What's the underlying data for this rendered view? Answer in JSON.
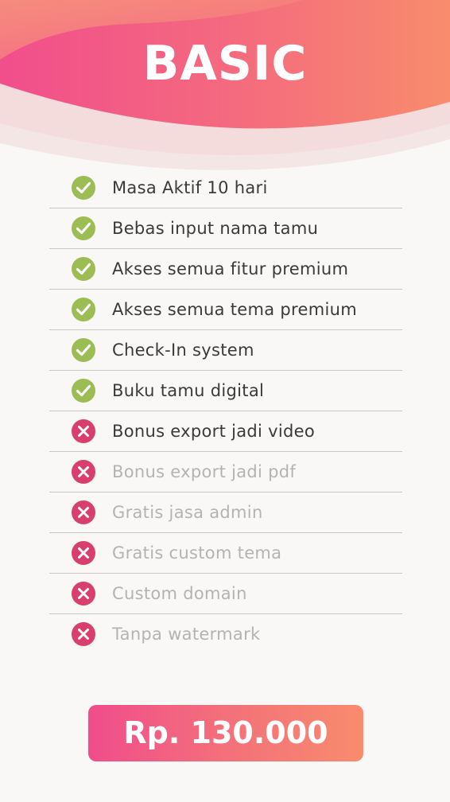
{
  "plan": {
    "title": "BASIC",
    "price": "Rp. 130.000"
  },
  "colors": {
    "accent_pink": "#f04d8b",
    "accent_orange": "#f88c6d",
    "check_green": "#9cbc54",
    "cross_red": "#d83e6e"
  },
  "features": [
    {
      "label": "Masa Aktif 10 hari",
      "included": true,
      "icon": "check-icon"
    },
    {
      "label": "Bebas input nama tamu",
      "included": true,
      "icon": "check-icon"
    },
    {
      "label": "Akses semua fitur premium",
      "included": true,
      "icon": "check-icon"
    },
    {
      "label": "Akses semua tema premium",
      "included": true,
      "icon": "check-icon"
    },
    {
      "label": "Check-In system",
      "included": true,
      "icon": "check-icon"
    },
    {
      "label": "Buku tamu digital",
      "included": true,
      "icon": "check-icon"
    },
    {
      "label": "Bonus export jadi video",
      "included": false,
      "icon": "cross-icon"
    },
    {
      "label": "Bonus export jadi pdf",
      "included": false,
      "icon": "cross-icon"
    },
    {
      "label": "Gratis jasa admin",
      "included": false,
      "icon": "cross-icon"
    },
    {
      "label": "Gratis custom tema",
      "included": false,
      "icon": "cross-icon"
    },
    {
      "label": "Custom domain",
      "included": false,
      "icon": "cross-icon"
    },
    {
      "label": "Tanpa watermark",
      "included": false,
      "icon": "cross-icon"
    }
  ]
}
